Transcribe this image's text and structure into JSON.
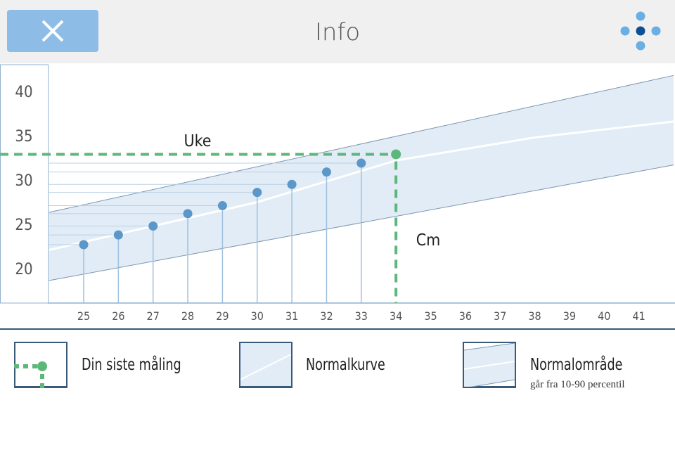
{
  "header": {
    "title": "Info",
    "close_icon": "close-icon",
    "menu_icon": "dots-menu-icon"
  },
  "colors": {
    "accent": "#8dbde6",
    "point": "#5b97c9",
    "latest": "#5db77a",
    "band": "#e1ecf6",
    "axis": "#8fb2d0"
  },
  "chart_data": {
    "type": "scatter",
    "xlim": [
      24,
      42
    ],
    "ylim": [
      16,
      43
    ],
    "x_ticks": [
      25,
      26,
      27,
      28,
      29,
      30,
      31,
      32,
      33,
      34,
      35,
      36,
      37,
      38,
      39,
      40,
      41
    ],
    "y_ticks": [
      20,
      25,
      30,
      35,
      40
    ],
    "measurements": {
      "x": [
        25,
        26,
        27,
        28,
        29,
        30,
        31,
        32,
        33
      ],
      "y": [
        22.7,
        23.8,
        24.8,
        26.2,
        27.1,
        28.6,
        29.5,
        30.9,
        31.9
      ]
    },
    "latest": {
      "x": 34,
      "y": 32.9
    },
    "normal_curve": {
      "x": [
        24,
        30,
        34,
        38,
        42
      ],
      "y": [
        22.1,
        27.5,
        32.2,
        34.8,
        36.6
      ]
    },
    "normal_range": {
      "x": [
        24,
        42
      ],
      "upper": [
        26.35,
        41.8
      ],
      "lower": [
        18.65,
        31.7
      ]
    },
    "annotations": {
      "week_label": "Uke",
      "cm_label": "Cm"
    }
  },
  "legend": [
    {
      "label": "Din siste måling"
    },
    {
      "label": "Normalkurve"
    },
    {
      "label": "Normalområde",
      "sub": "går fra 10-90 percentil"
    }
  ]
}
